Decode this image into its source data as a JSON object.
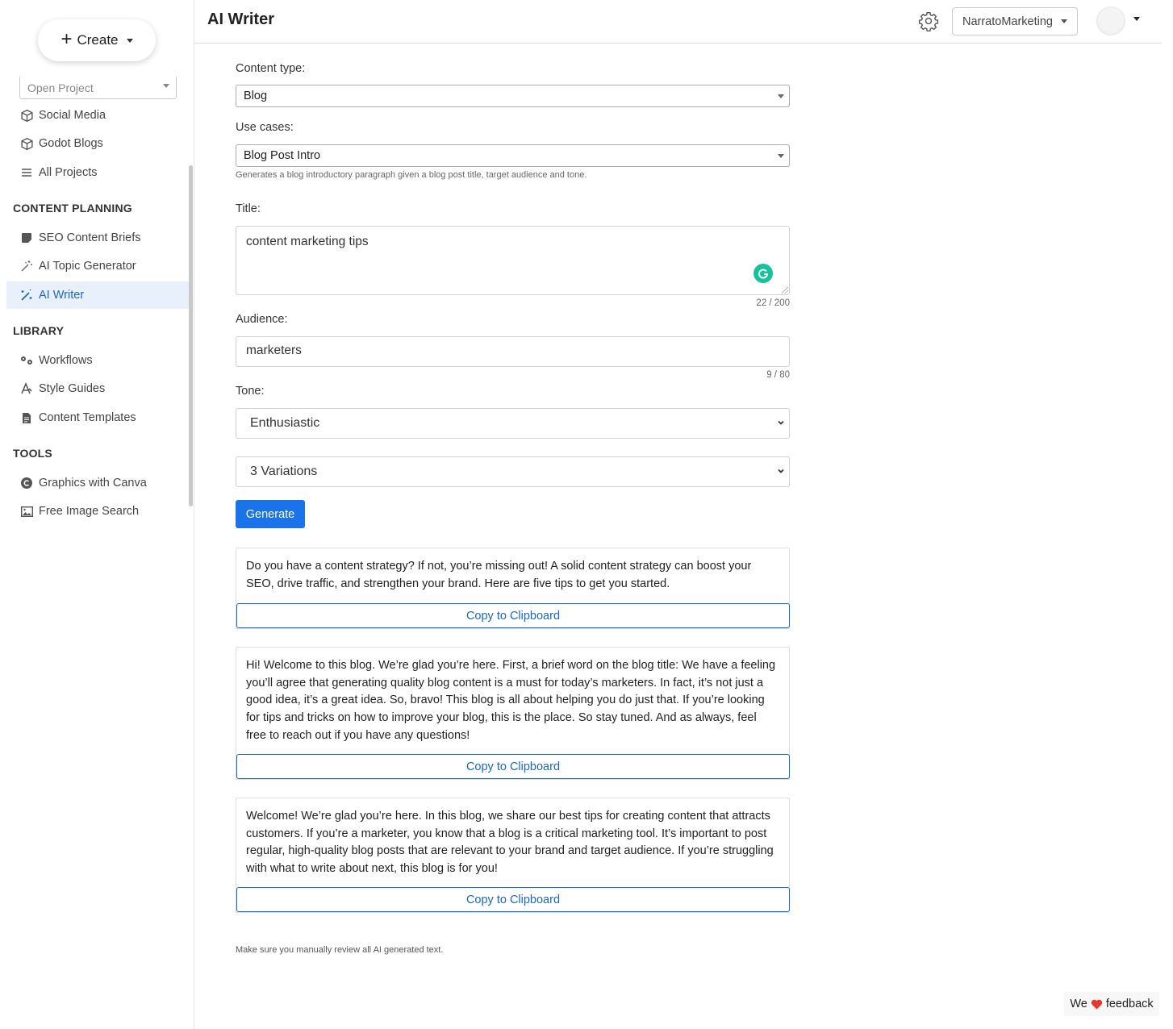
{
  "sidebar": {
    "create_label": "Create",
    "open_project_placeholder": "Open Project",
    "projects": [
      {
        "label": "Social Media",
        "icon": "cube-icon"
      },
      {
        "label": "Godot Blogs",
        "icon": "cube-icon"
      },
      {
        "label": "All Projects",
        "icon": "list-icon"
      }
    ],
    "sections": [
      {
        "title": "CONTENT PLANNING",
        "items": [
          {
            "label": "SEO Content Briefs",
            "icon": "note-icon"
          },
          {
            "label": "AI Topic Generator",
            "icon": "magic-wand-icon"
          },
          {
            "label": "AI Writer",
            "icon": "magic-wand-sparkle-icon",
            "active": true
          }
        ]
      },
      {
        "title": "LIBRARY",
        "items": [
          {
            "label": "Workflows",
            "icon": "gears-icon"
          },
          {
            "label": "Style Guides",
            "icon": "pen-nib-icon"
          },
          {
            "label": "Content Templates",
            "icon": "document-icon"
          }
        ]
      },
      {
        "title": "TOOLS",
        "items": [
          {
            "label": "Graphics with Canva",
            "icon": "canva-icon"
          },
          {
            "label": "Free Image Search",
            "icon": "image-icon"
          }
        ]
      }
    ]
  },
  "header": {
    "title": "AI Writer",
    "account_label": "NarratoMarketing"
  },
  "form": {
    "content_type_label": "Content type:",
    "content_type_value": "Blog",
    "use_cases_label": "Use cases:",
    "use_case_value": "Blog Post Intro",
    "use_case_help": "Generates a blog introductory paragraph given a blog post title, target audience and tone.",
    "title_label": "Title:",
    "title_value": "content marketing tips",
    "title_counter": "22 / 200",
    "audience_label": "Audience:",
    "audience_value": "marketers",
    "audience_counter": "9 / 80",
    "tone_label": "Tone:",
    "tone_value": "Enthusiastic",
    "variations_value": "3 Variations",
    "generate_label": "Generate"
  },
  "results": [
    {
      "text": "Do you have a content strategy? If not, you’re missing out! A solid content strategy can boost your SEO, drive traffic, and strengthen your brand. Here are five tips to get you started.",
      "copy_label": "Copy to Clipboard"
    },
    {
      "text": "Hi! Welcome to this blog. We’re glad you’re here. First, a brief word on the blog title: We have a feeling you’ll agree that generating quality blog content is a must for today’s marketers. In fact, it’s not just a good idea, it’s a great idea. So, bravo! This blog is all about helping you do just that. If you’re looking for tips and tricks on how to improve your blog, this is the place. So stay tuned. And as always, feel free to reach out if you have any questions!",
      "copy_label": "Copy to Clipboard"
    },
    {
      "text": "Welcome! We’re glad you’re here. In this blog, we share our best tips for creating content that attracts customers. If you’re a marketer, you know that a blog is a critical marketing tool. It’s important to post regular, high-quality blog posts that are relevant to your brand and target audience. If you’re struggling with what to write about next, this blog is for you!",
      "copy_label": "Copy to Clipboard"
    }
  ],
  "disclaimer": "Make sure you manually review all AI generated text.",
  "feedback": {
    "prefix": "We",
    "suffix": "feedback"
  },
  "colors": {
    "accent": "#1a73e8",
    "active_bg": "#e8f0fb",
    "grammarly": "#15c39a",
    "heart": "#e8372c"
  }
}
